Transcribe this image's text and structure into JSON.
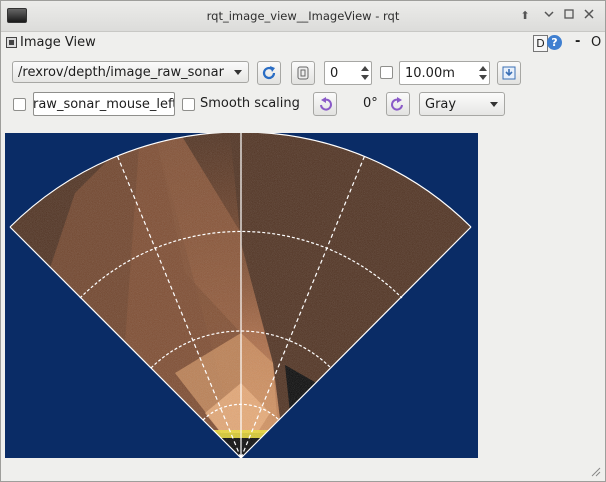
{
  "window": {
    "title": "rqt_image_view__ImageView - rqt",
    "buttons": {
      "up": "⬆",
      "restore": "⏷",
      "maximize": "▫",
      "close": "✕"
    }
  },
  "dock": {
    "title": "Image View",
    "d_label": "D",
    "help_label": "?",
    "min_label": "-",
    "close_label": "O"
  },
  "toolbar": {
    "topic": "/rexrov/depth/image_raw_sonar",
    "refresh_icon": "refresh-icon",
    "zoom_icon": "zoom-fit-icon",
    "zoom_value": "0",
    "max_range_value": "10.00m",
    "save_icon": "save-icon"
  },
  "toolbar2": {
    "publish_topic": "raw_sonar_mouse_left",
    "smooth_label": "Smooth scaling",
    "rotate_left_icon": "rotate-left-icon",
    "rotation_value": "0°",
    "rotate_right_icon": "rotate-right-icon",
    "colormap": "Gray"
  },
  "image": {
    "description_colors": {
      "background": "#0a2c66",
      "sonar": "#4a2a18",
      "bright": "#d08a55",
      "highlight": "#f0e030"
    }
  }
}
